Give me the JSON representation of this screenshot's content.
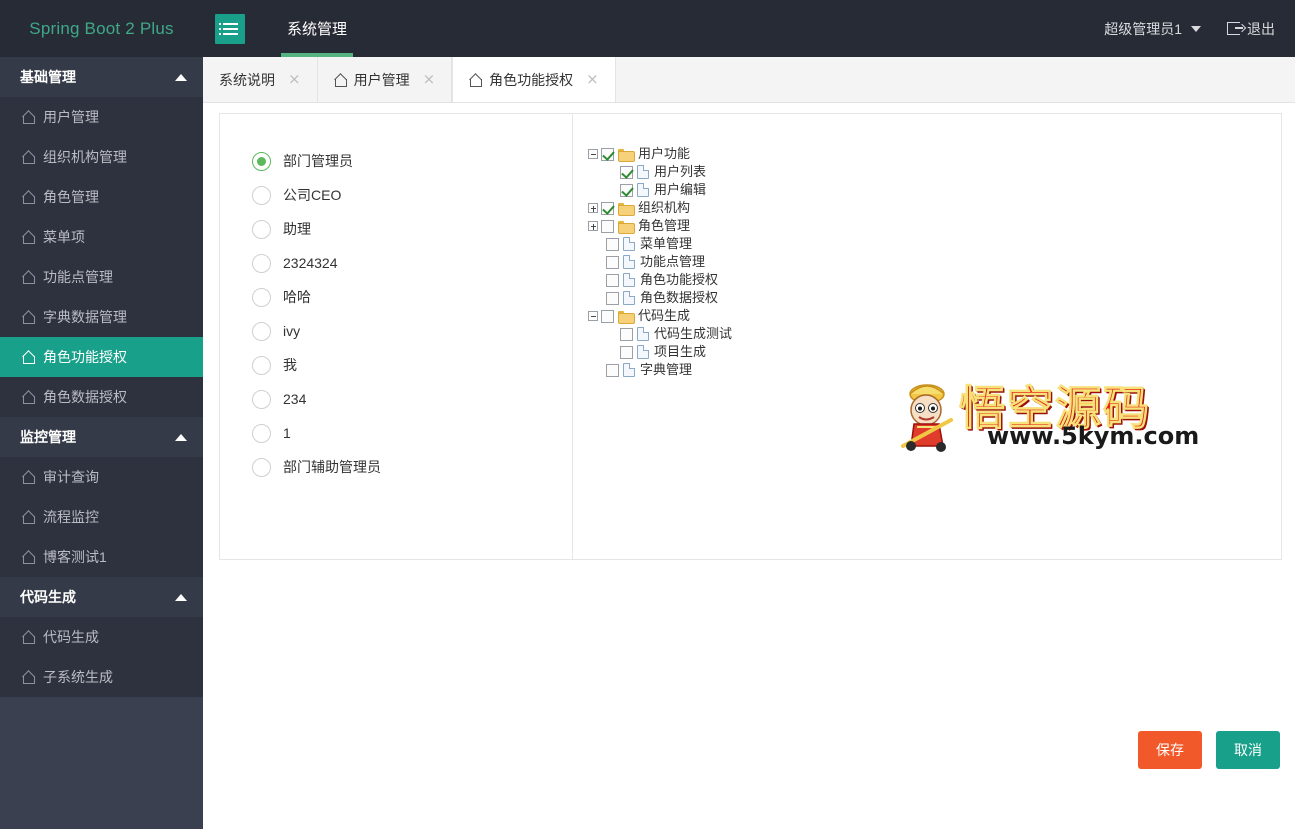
{
  "header": {
    "brand": "Spring Boot 2 Plus",
    "menu_toggle_icon": "hamburger-list-icon",
    "nav_title": "系统管理",
    "user_name": "超级管理员1",
    "user_caret_icon": "chevron-down-icon",
    "logout_icon": "logout-icon",
    "logout_label": "退出",
    "accent_color": "#18a08a",
    "brand_color": "#3fa987",
    "bg_color": "#272b35"
  },
  "sidebar": {
    "groups": [
      {
        "label": "基础管理",
        "caret_icon": "chevron-up-icon",
        "items": [
          {
            "label": "用户管理",
            "icon": "home-icon",
            "active": false
          },
          {
            "label": "组织机构管理",
            "icon": "home-icon",
            "active": false
          },
          {
            "label": "角色管理",
            "icon": "home-icon",
            "active": false
          },
          {
            "label": "菜单项",
            "icon": "home-icon",
            "active": false
          },
          {
            "label": "功能点管理",
            "icon": "home-icon",
            "active": false
          },
          {
            "label": "字典数据管理",
            "icon": "home-icon",
            "active": false
          },
          {
            "label": "角色功能授权",
            "icon": "home-icon",
            "active": true
          },
          {
            "label": "角色数据授权",
            "icon": "home-icon",
            "active": false
          }
        ]
      },
      {
        "label": "监控管理",
        "caret_icon": "chevron-up-icon",
        "items": [
          {
            "label": "审计查询",
            "icon": "home-icon",
            "active": false
          },
          {
            "label": "流程监控",
            "icon": "home-icon",
            "active": false
          },
          {
            "label": "博客测试1",
            "icon": "home-icon",
            "active": false
          }
        ]
      },
      {
        "label": "代码生成",
        "caret_icon": "chevron-up-icon",
        "items": [
          {
            "label": "代码生成",
            "icon": "home-icon",
            "active": false
          },
          {
            "label": "子系统生成",
            "icon": "home-icon",
            "active": false
          }
        ]
      }
    ]
  },
  "tabs": [
    {
      "label": "系统说明",
      "icon": null,
      "close_icon": "close-icon",
      "active": false
    },
    {
      "label": "用户管理",
      "icon": "home-icon",
      "close_icon": "close-icon",
      "active": false
    },
    {
      "label": "角色功能授权",
      "icon": "home-icon",
      "close_icon": "close-icon",
      "active": true
    }
  ],
  "roles": {
    "selected_index": 0,
    "options": [
      "部门管理员",
      "公司CEO",
      "助理",
      "2324324",
      "哈哈",
      "ivy",
      "我",
      "234",
      "1",
      "部门辅助管理员"
    ]
  },
  "tree": {
    "nodes": [
      {
        "label": "用户功能",
        "depth": 0,
        "expander": "minus",
        "checked": true,
        "icon": "folder-icon"
      },
      {
        "label": "用户列表",
        "depth": 1,
        "expander": "none",
        "checked": true,
        "icon": "page-icon"
      },
      {
        "label": "用户编辑",
        "depth": 1,
        "expander": "none",
        "checked": true,
        "icon": "page-icon"
      },
      {
        "label": "组织机构",
        "depth": 0,
        "expander": "plus",
        "checked": true,
        "icon": "folder-icon"
      },
      {
        "label": "角色管理",
        "depth": 0,
        "expander": "plus",
        "checked": false,
        "icon": "folder-icon"
      },
      {
        "label": "菜单管理",
        "depth": 0,
        "expander": "none",
        "checked": false,
        "icon": "page-icon"
      },
      {
        "label": "功能点管理",
        "depth": 0,
        "expander": "none",
        "checked": false,
        "icon": "page-icon"
      },
      {
        "label": "角色功能授权",
        "depth": 0,
        "expander": "none",
        "checked": false,
        "icon": "page-icon"
      },
      {
        "label": "角色数据授权",
        "depth": 0,
        "expander": "none",
        "checked": false,
        "icon": "page-icon"
      },
      {
        "label": "代码生成",
        "depth": 0,
        "expander": "minus",
        "checked": false,
        "icon": "folder-icon"
      },
      {
        "label": "代码生成测试",
        "depth": 1,
        "expander": "none",
        "checked": false,
        "icon": "page-icon"
      },
      {
        "label": "项目生成",
        "depth": 1,
        "expander": "none",
        "checked": false,
        "icon": "page-icon"
      },
      {
        "label": "字典管理",
        "depth": 0,
        "expander": "none",
        "checked": false,
        "icon": "page-icon"
      }
    ]
  },
  "watermark": {
    "text": "悟空源码",
    "url": "www.5kym.com",
    "mascot_icon": "monkey-king-mascot-icon",
    "color": "#e8241c"
  },
  "footer": {
    "save_label": "保存",
    "save_color": "#f1592a",
    "cancel_label": "取消",
    "cancel_color": "#18a08a"
  }
}
